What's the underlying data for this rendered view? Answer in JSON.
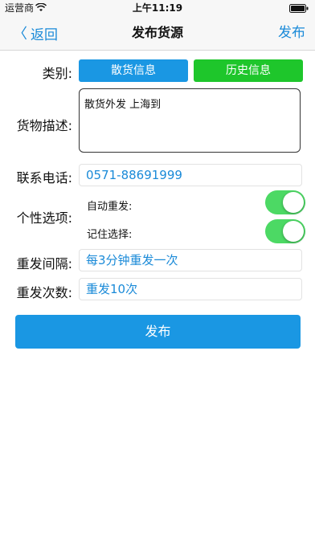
{
  "status_bar": {
    "carrier": "运营商",
    "time": "上午11:19"
  },
  "nav": {
    "back_label": "返回",
    "title": "发布货源",
    "publish_label": "发布"
  },
  "form": {
    "category_label": "类别:",
    "category_buttons": {
      "scatter": "散货信息",
      "history": "历史信息"
    },
    "description_label": "货物描述:",
    "description_value": "散货外发 上海到",
    "phone_label": "联系电话:",
    "phone_value": "0571-88691999",
    "options_label": "个性选项:",
    "options": [
      {
        "label": "自动重发:",
        "enabled": true
      },
      {
        "label": "记住选择:",
        "enabled": true
      }
    ],
    "interval_label": "重发间隔:",
    "interval_value": "每3分钟重发一次",
    "count_label": "重发次数:",
    "count_value": "重发10次"
  },
  "submit_label": "发布",
  "colors": {
    "accent_blue": "#1a97e3",
    "link_blue": "#1a8ad8",
    "history_green": "#1ec62b",
    "toggle_green": "#4cd964"
  }
}
